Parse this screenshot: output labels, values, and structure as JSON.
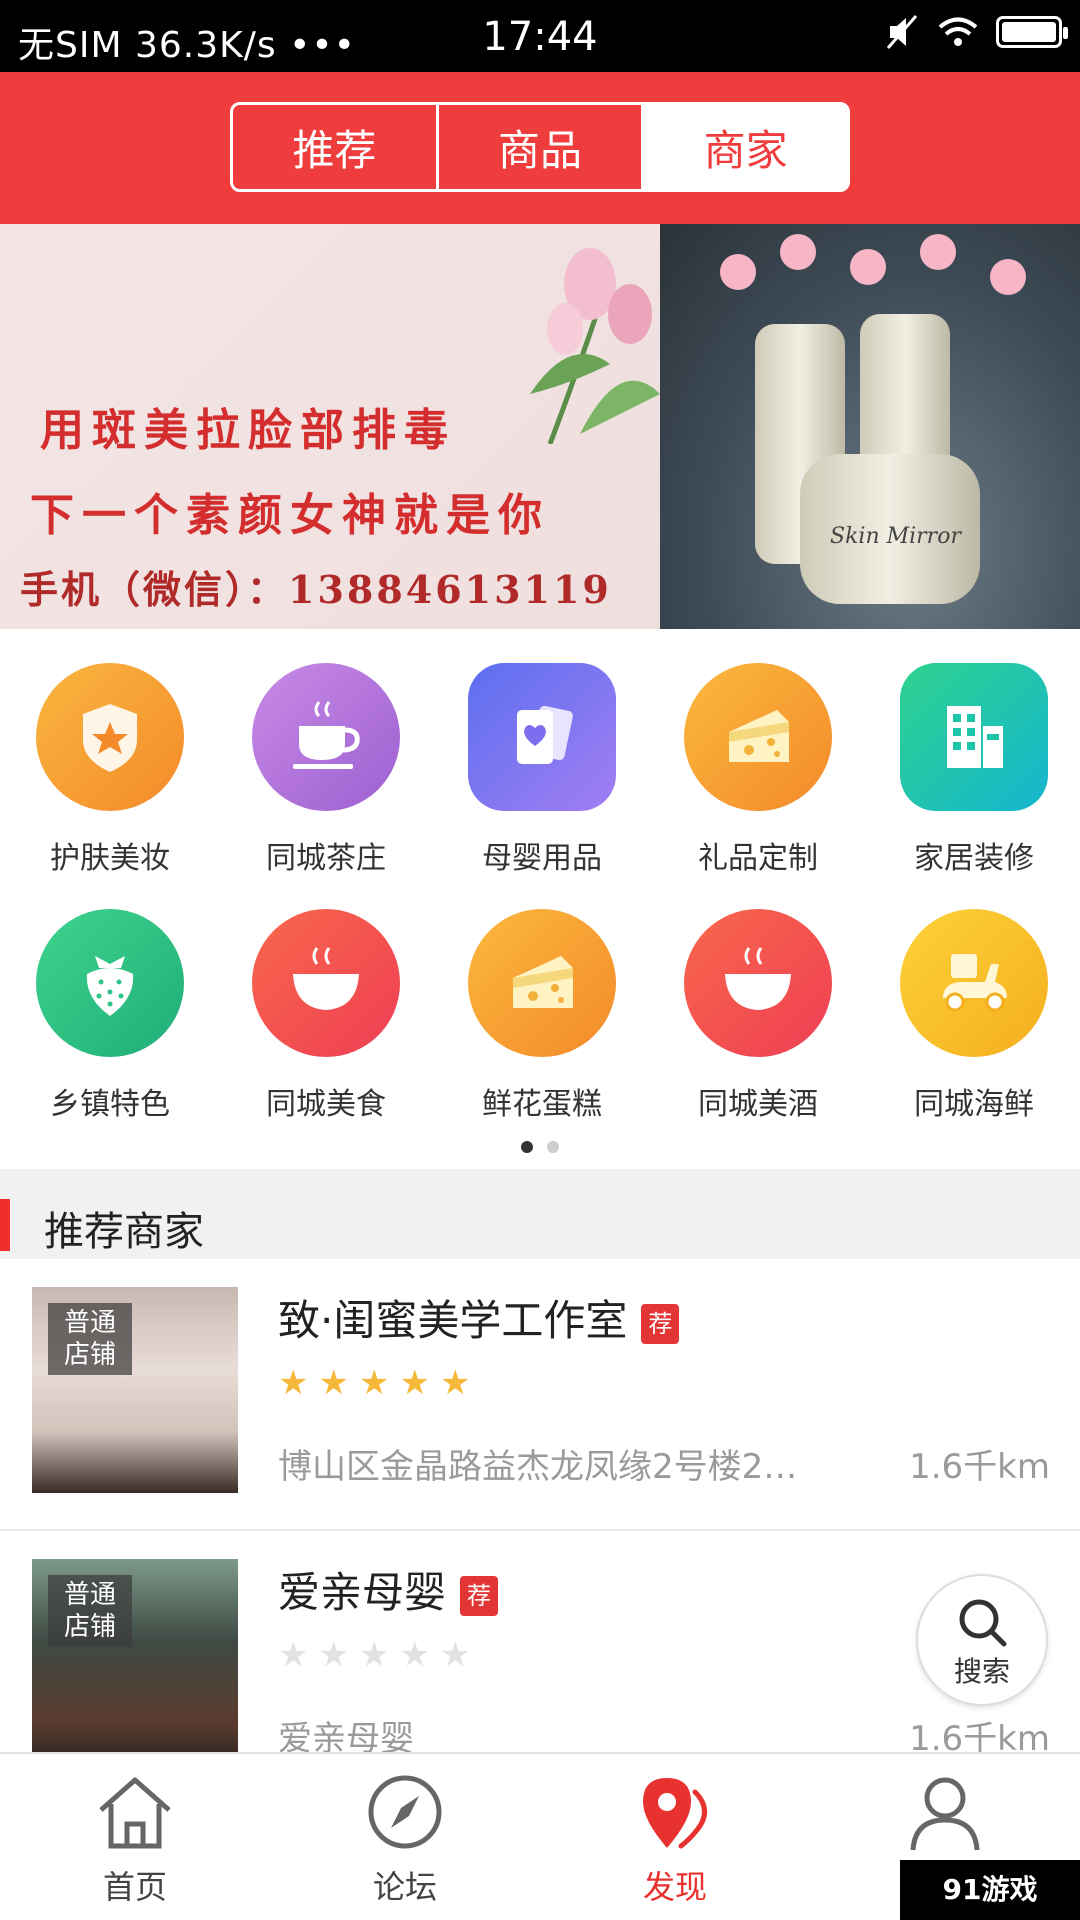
{
  "status_bar": {
    "carrier": "无SIM",
    "speed": "36.3K/s",
    "dots": "•••",
    "time": "17:44"
  },
  "header": {
    "tabs": [
      {
        "label": "推荐",
        "active": false
      },
      {
        "label": "商品",
        "active": false
      },
      {
        "label": "商家",
        "active": true
      }
    ]
  },
  "banner": {
    "line1": "用斑美拉脸部排毒",
    "line2": "下一个素颜女神就是你",
    "line3": "手机（微信）：13884613119",
    "product_label": "Skin Mirror"
  },
  "categories": [
    {
      "label": "护肤美妆",
      "icon": "shield-star-icon",
      "color": "#f7a02f"
    },
    {
      "label": "同城茶庄",
      "icon": "teacup-icon",
      "color": "#b36fd6"
    },
    {
      "label": "母婴用品",
      "icon": "cards-heart-icon",
      "color": "#7f6df0"
    },
    {
      "label": "礼品定制",
      "icon": "cheese-icon",
      "color": "#f6a52e"
    },
    {
      "label": "家居装修",
      "icon": "building-icon",
      "color": "#1ec6a9"
    },
    {
      "label": "乡镇特色",
      "icon": "strawberry-icon",
      "color": "#2cc487"
    },
    {
      "label": "同城美食",
      "icon": "bowl-icon",
      "color": "#f4514d"
    },
    {
      "label": "鲜花蛋糕",
      "icon": "cheese-icon",
      "color": "#f6a52e"
    },
    {
      "label": "同城美酒",
      "icon": "bowl-icon",
      "color": "#f4514d"
    },
    {
      "label": "同城海鲜",
      "icon": "scooter-icon",
      "color": "#f8c22b"
    }
  ],
  "pagination": {
    "pages": 2,
    "current": 1
  },
  "section": {
    "title": "推荐商家"
  },
  "shops": [
    {
      "tag": "普通店铺",
      "name": "致·闺蜜美学工作室",
      "badge": "荐",
      "rating": 5,
      "address": "博山区金晶路益杰龙凤缘2号楼2…",
      "distance": "1.6千km"
    },
    {
      "tag": "普通店铺",
      "name": "爱亲母婴",
      "badge": "荐",
      "rating": 0,
      "address": "爱亲母婴",
      "distance": "1.6千km"
    }
  ],
  "fab": {
    "label": "搜索"
  },
  "tabbar": [
    {
      "label": "首页",
      "icon": "home-icon",
      "active": false
    },
    {
      "label": "论坛",
      "icon": "compass-icon",
      "active": false
    },
    {
      "label": "发现",
      "icon": "location-pin-icon",
      "active": true
    },
    {
      "label": "我",
      "icon": "user-icon",
      "active": false
    }
  ],
  "watermark": "91游戏",
  "colors": {
    "brand_red": "#ef3c3c",
    "star": "#f6b83a",
    "active_tab": "#e8322f"
  }
}
